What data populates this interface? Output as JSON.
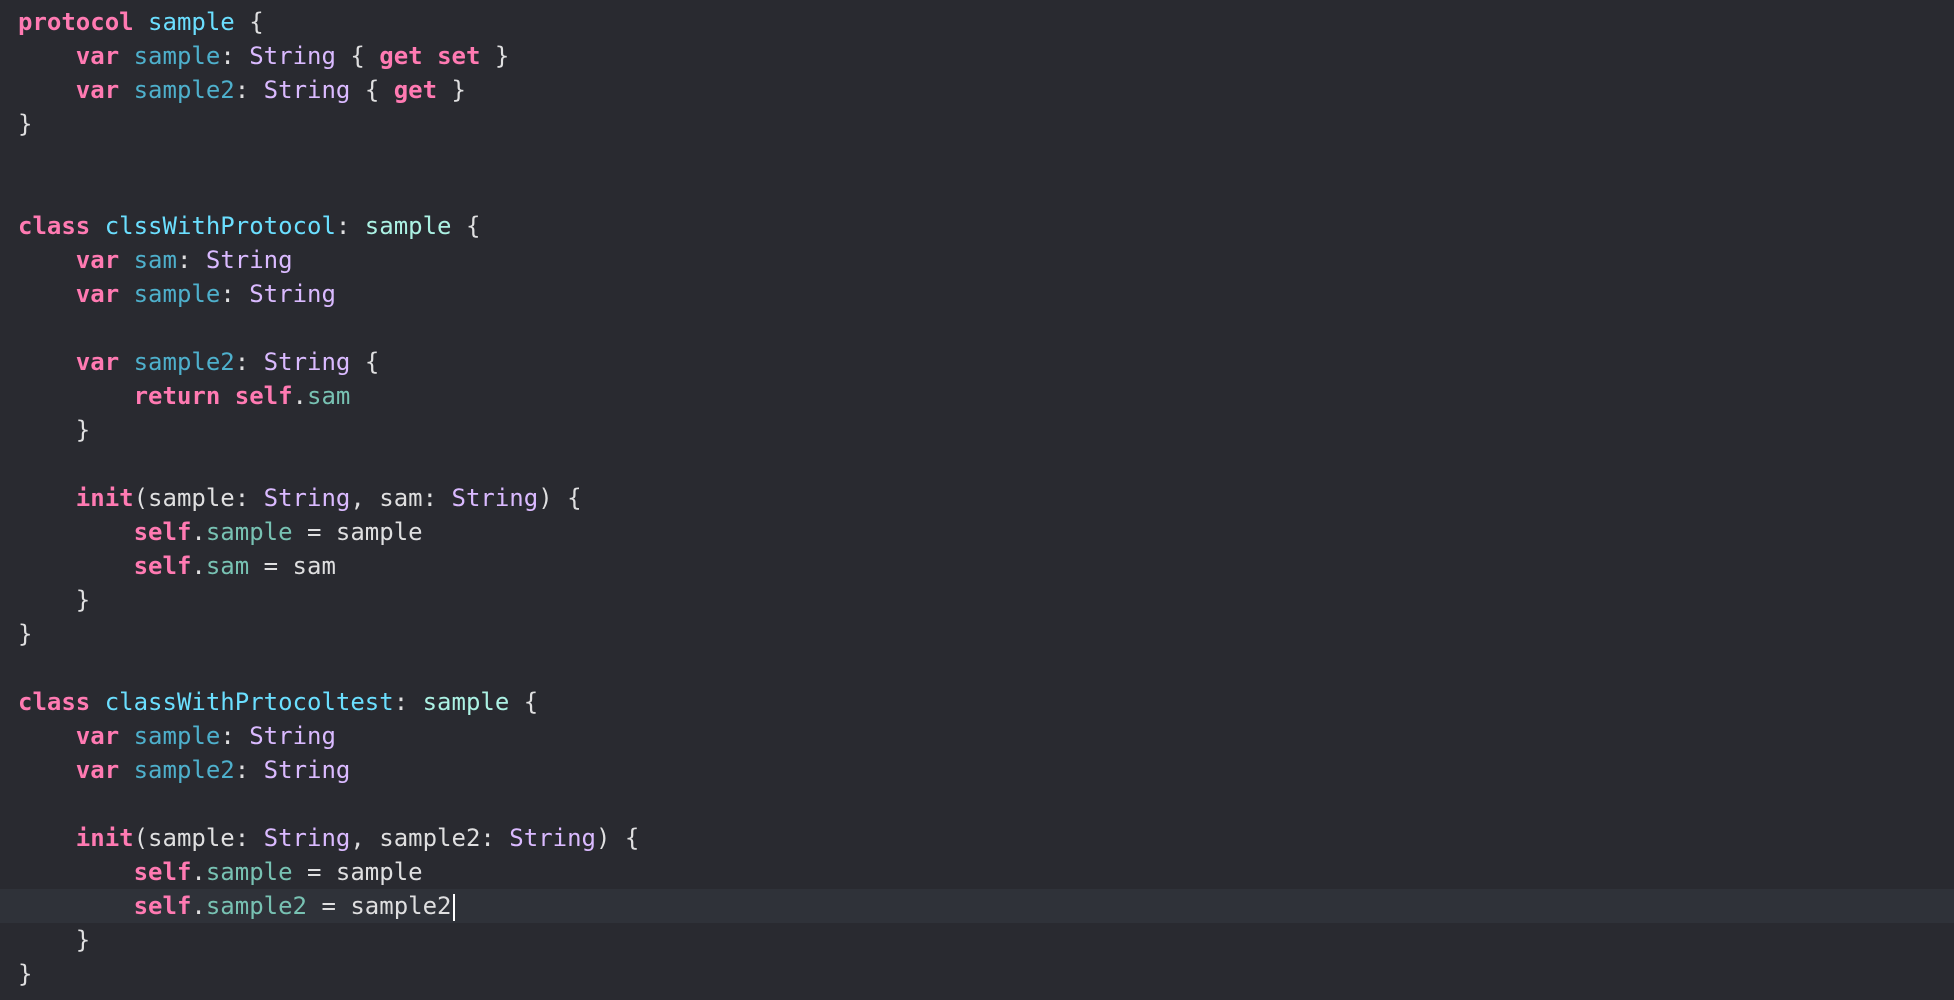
{
  "editor": {
    "current_line": 26,
    "lines": [
      [
        {
          "t": "protocol",
          "c": "kw"
        },
        {
          "t": " ",
          "c": "plain"
        },
        {
          "t": "sample",
          "c": "decl"
        },
        {
          "t": " {",
          "c": "plain"
        }
      ],
      [
        {
          "t": "    ",
          "c": "plain"
        },
        {
          "t": "var",
          "c": "kw"
        },
        {
          "t": " ",
          "c": "plain"
        },
        {
          "t": "sample",
          "c": "prop"
        },
        {
          "t": ": ",
          "c": "plain"
        },
        {
          "t": "String",
          "c": "type"
        },
        {
          "t": " { ",
          "c": "plain"
        },
        {
          "t": "get",
          "c": "kw"
        },
        {
          "t": " ",
          "c": "plain"
        },
        {
          "t": "set",
          "c": "kw"
        },
        {
          "t": " }",
          "c": "plain"
        }
      ],
      [
        {
          "t": "    ",
          "c": "plain"
        },
        {
          "t": "var",
          "c": "kw"
        },
        {
          "t": " ",
          "c": "plain"
        },
        {
          "t": "sample2",
          "c": "prop"
        },
        {
          "t": ": ",
          "c": "plain"
        },
        {
          "t": "String",
          "c": "type"
        },
        {
          "t": " { ",
          "c": "plain"
        },
        {
          "t": "get",
          "c": "kw"
        },
        {
          "t": " }",
          "c": "plain"
        }
      ],
      [
        {
          "t": "}",
          "c": "plain"
        }
      ],
      [],
      [],
      [
        {
          "t": "class",
          "c": "kw"
        },
        {
          "t": " ",
          "c": "plain"
        },
        {
          "t": "clssWithProtocol",
          "c": "decl"
        },
        {
          "t": ": ",
          "c": "plain"
        },
        {
          "t": "sample",
          "c": "protoref"
        },
        {
          "t": " {",
          "c": "plain"
        }
      ],
      [
        {
          "t": "    ",
          "c": "plain"
        },
        {
          "t": "var",
          "c": "kw"
        },
        {
          "t": " ",
          "c": "plain"
        },
        {
          "t": "sam",
          "c": "prop"
        },
        {
          "t": ": ",
          "c": "plain"
        },
        {
          "t": "String",
          "c": "type"
        }
      ],
      [
        {
          "t": "    ",
          "c": "plain"
        },
        {
          "t": "var",
          "c": "kw"
        },
        {
          "t": " ",
          "c": "plain"
        },
        {
          "t": "sample",
          "c": "prop"
        },
        {
          "t": ": ",
          "c": "plain"
        },
        {
          "t": "String",
          "c": "type"
        }
      ],
      [],
      [
        {
          "t": "    ",
          "c": "plain"
        },
        {
          "t": "var",
          "c": "kw"
        },
        {
          "t": " ",
          "c": "plain"
        },
        {
          "t": "sample2",
          "c": "prop"
        },
        {
          "t": ": ",
          "c": "plain"
        },
        {
          "t": "String",
          "c": "type"
        },
        {
          "t": " {",
          "c": "plain"
        }
      ],
      [
        {
          "t": "        ",
          "c": "plain"
        },
        {
          "t": "return",
          "c": "kw"
        },
        {
          "t": " ",
          "c": "plain"
        },
        {
          "t": "self",
          "c": "kw"
        },
        {
          "t": ".",
          "c": "plain"
        },
        {
          "t": "sam",
          "c": "member"
        }
      ],
      [
        {
          "t": "    }",
          "c": "plain"
        }
      ],
      [],
      [
        {
          "t": "    ",
          "c": "plain"
        },
        {
          "t": "init",
          "c": "kw"
        },
        {
          "t": "(sample: ",
          "c": "plain"
        },
        {
          "t": "String",
          "c": "type"
        },
        {
          "t": ", sam: ",
          "c": "plain"
        },
        {
          "t": "String",
          "c": "type"
        },
        {
          "t": ") {",
          "c": "plain"
        }
      ],
      [
        {
          "t": "        ",
          "c": "plain"
        },
        {
          "t": "self",
          "c": "kw"
        },
        {
          "t": ".",
          "c": "plain"
        },
        {
          "t": "sample",
          "c": "member"
        },
        {
          "t": " = sample",
          "c": "plain"
        }
      ],
      [
        {
          "t": "        ",
          "c": "plain"
        },
        {
          "t": "self",
          "c": "kw"
        },
        {
          "t": ".",
          "c": "plain"
        },
        {
          "t": "sam",
          "c": "member"
        },
        {
          "t": " = sam",
          "c": "plain"
        }
      ],
      [
        {
          "t": "    }",
          "c": "plain"
        }
      ],
      [
        {
          "t": "}",
          "c": "plain"
        }
      ],
      [],
      [
        {
          "t": "class",
          "c": "kw"
        },
        {
          "t": " ",
          "c": "plain"
        },
        {
          "t": "classWithPrtocoltest",
          "c": "decl"
        },
        {
          "t": ": ",
          "c": "plain"
        },
        {
          "t": "sample",
          "c": "protoref"
        },
        {
          "t": " {",
          "c": "plain"
        }
      ],
      [
        {
          "t": "    ",
          "c": "plain"
        },
        {
          "t": "var",
          "c": "kw"
        },
        {
          "t": " ",
          "c": "plain"
        },
        {
          "t": "sample",
          "c": "prop"
        },
        {
          "t": ": ",
          "c": "plain"
        },
        {
          "t": "String",
          "c": "type"
        }
      ],
      [
        {
          "t": "    ",
          "c": "plain"
        },
        {
          "t": "var",
          "c": "kw"
        },
        {
          "t": " ",
          "c": "plain"
        },
        {
          "t": "sample2",
          "c": "prop"
        },
        {
          "t": ": ",
          "c": "plain"
        },
        {
          "t": "String",
          "c": "type"
        }
      ],
      [],
      [
        {
          "t": "    ",
          "c": "plain"
        },
        {
          "t": "init",
          "c": "kw"
        },
        {
          "t": "(sample: ",
          "c": "plain"
        },
        {
          "t": "String",
          "c": "type"
        },
        {
          "t": ", sample2: ",
          "c": "plain"
        },
        {
          "t": "String",
          "c": "type"
        },
        {
          "t": ") {",
          "c": "plain"
        }
      ],
      [
        {
          "t": "        ",
          "c": "plain"
        },
        {
          "t": "self",
          "c": "kw"
        },
        {
          "t": ".",
          "c": "plain"
        },
        {
          "t": "sample",
          "c": "member"
        },
        {
          "t": " = sample",
          "c": "plain"
        }
      ],
      [
        {
          "t": "        ",
          "c": "plain"
        },
        {
          "t": "self",
          "c": "kw"
        },
        {
          "t": ".",
          "c": "plain"
        },
        {
          "t": "sample2",
          "c": "member"
        },
        {
          "t": " = sample2",
          "c": "plain"
        }
      ],
      [
        {
          "t": "    }",
          "c": "plain"
        }
      ],
      [
        {
          "t": "}",
          "c": "plain"
        }
      ]
    ]
  },
  "colors": {
    "background": "#292a30",
    "current_line_highlight": "#2f3239",
    "keyword": "#ff7ab2",
    "type": "#dabaff",
    "declaration": "#6bdfff",
    "property": "#4eb0cc",
    "member": "#78c2b3",
    "protocol_reference": "#acf2e4",
    "plain_text": "#dfdfe0"
  }
}
